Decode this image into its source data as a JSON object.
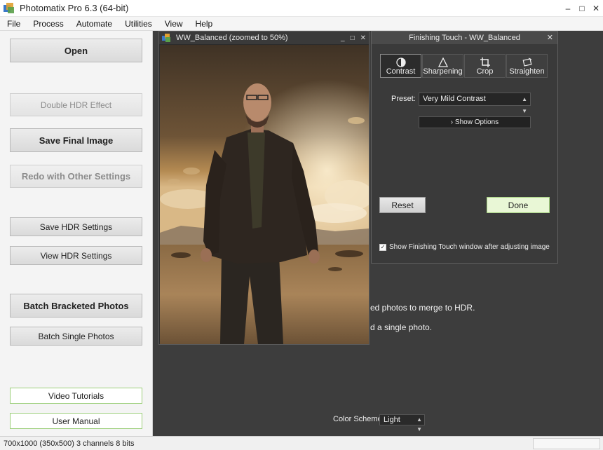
{
  "window": {
    "title": "Photomatix Pro 6.3 (64-bit)"
  },
  "menu": [
    "File",
    "Process",
    "Automate",
    "Utilities",
    "View",
    "Help"
  ],
  "left_panel": {
    "open": "Open",
    "double_hdr": "Double HDR Effect",
    "save_final": "Save Final Image",
    "redo": "Redo with Other Settings",
    "save_hdr_settings": "Save HDR Settings",
    "view_hdr_settings": "View HDR Settings",
    "batch_bracketed": "Batch Bracketed Photos",
    "batch_single": "Batch Single Photos",
    "video_tutorials": "Video Tutorials",
    "user_manual": "User Manual"
  },
  "image_window": {
    "title": "WW_Balanced (zoomed to 50%)"
  },
  "workspace": {
    "hint_merge": "ed photos to merge to HDR.",
    "hint_single": "d a single photo.",
    "color_scheme_label": "Color Scheme:",
    "color_scheme_value": "Light"
  },
  "finishing_touch": {
    "title": "Finishing Touch - WW_Balanced",
    "tools": [
      {
        "label": "Contrast",
        "icon": "contrast-icon",
        "active": true
      },
      {
        "label": "Sharpening",
        "icon": "triangle-icon",
        "active": false
      },
      {
        "label": "Crop",
        "icon": "crop-icon",
        "active": false
      },
      {
        "label": "Straighten",
        "icon": "straighten-icon",
        "active": false
      }
    ],
    "preset_label": "Preset:",
    "preset_value": "Very Mild Contrast",
    "show_options": "Show Options",
    "reset": "Reset",
    "done": "Done",
    "show_after_adjust": "Show Finishing Touch window after adjusting image",
    "show_after_adjust_checked": true
  },
  "status": {
    "text": "700x1000 (350x500) 3 channels 8 bits"
  },
  "colors": {
    "workspace_bg": "#3d3d3d",
    "done_green": "#e9f7d6",
    "link_green_border": "#9ccf7a"
  }
}
